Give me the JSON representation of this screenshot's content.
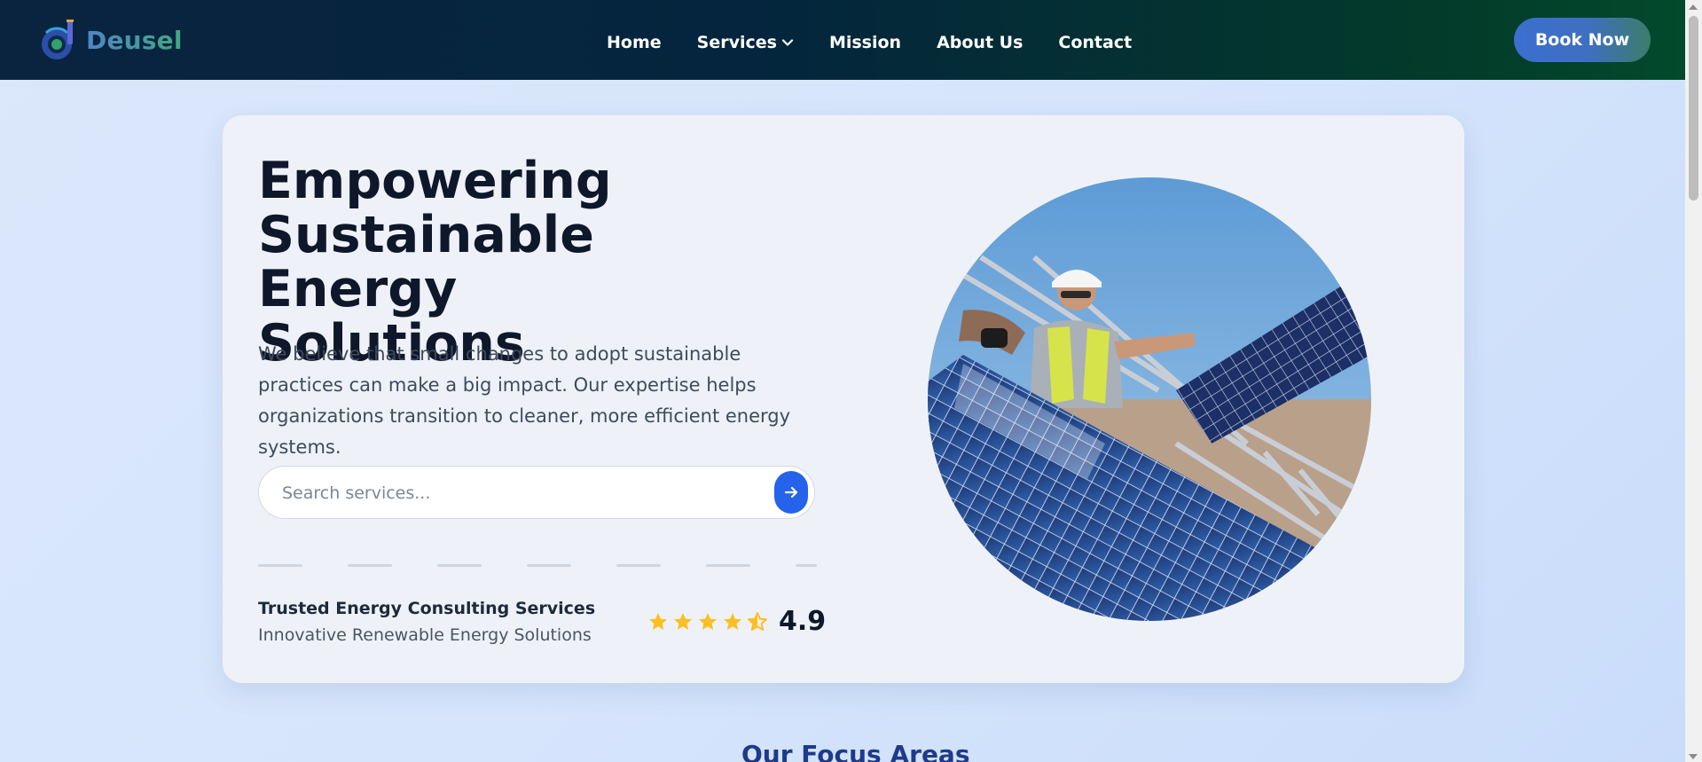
{
  "brand": {
    "name": "Deusel",
    "gradient_start": "#4f86c6",
    "gradient_end": "#43a77f"
  },
  "nav": {
    "items": [
      {
        "label": "Home"
      },
      {
        "label": "Services",
        "has_dropdown": true,
        "icon": "chevron-down-icon"
      },
      {
        "label": "Mission"
      },
      {
        "label": "About Us"
      },
      {
        "label": "Contact"
      }
    ],
    "cta_label": "Book Now"
  },
  "hero": {
    "title_lines": [
      "Empowering",
      "Sustainable Energy",
      "Solutions"
    ],
    "description": "We believe that small changes to adopt sustainable practices can make a big impact. Our expertise helps organizations transition to cleaner, more efficient energy systems.",
    "search": {
      "placeholder": "Search services...",
      "value": "",
      "button_icon": "arrow-right-icon"
    },
    "trust": {
      "title": "Trusted Energy Consulting Services",
      "subtitle": "Innovative Renewable Energy Solutions",
      "rating": "4.9",
      "stars_full": 4,
      "stars_half": 1
    },
    "image_subject": "worker installing solar panels"
  },
  "sections": {
    "focus_title": "Our Focus Areas"
  },
  "colors": {
    "accent": "#2563eb",
    "star": "#fbbf24",
    "heading": "#0f172a",
    "section_heading": "#1e3a8a"
  }
}
